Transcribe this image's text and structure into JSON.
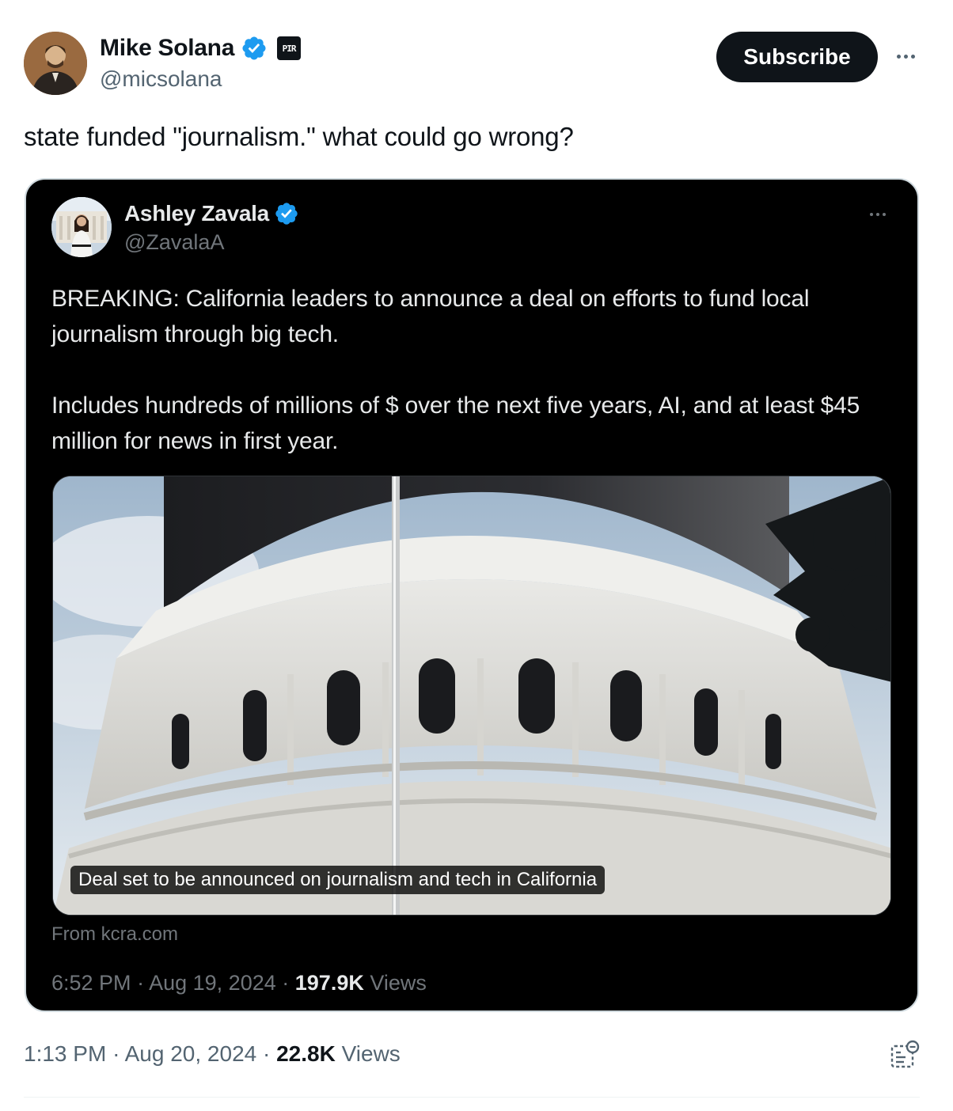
{
  "author": {
    "name": "Mike Solana",
    "handle": "@micsolana",
    "affiliation_badge": "PIR"
  },
  "subscribe_label": "Subscribe",
  "tweet_text": "state funded \"journalism.\" what could go wrong?",
  "quoted": {
    "name": "Ashley Zavala",
    "handle": "@ZavalaA",
    "paragraphs": [
      "BREAKING: California leaders to announce a deal on efforts to fund local journalism through big tech.",
      "Includes hundreds of millions of $ over the next five years, AI, and at least $45 million for news in first year."
    ],
    "media_caption": "Deal set to be announced on journalism and tech in California",
    "source": "From kcra.com",
    "time": "6:52 PM",
    "date": "Aug 19, 2024",
    "views_count": "197.9K",
    "views_label": "Views"
  },
  "meta": {
    "time": "1:13 PM",
    "date": "Aug 20, 2024",
    "views_count": "22.8K",
    "views_label": "Views"
  },
  "colors": {
    "verified": "#1d9bf0",
    "primary_text": "#0f1419",
    "secondary_text": "#536471",
    "quote_bg": "#000000"
  },
  "icons": [
    "verified-badge-icon",
    "more-options-icon",
    "analytics-icon"
  ]
}
